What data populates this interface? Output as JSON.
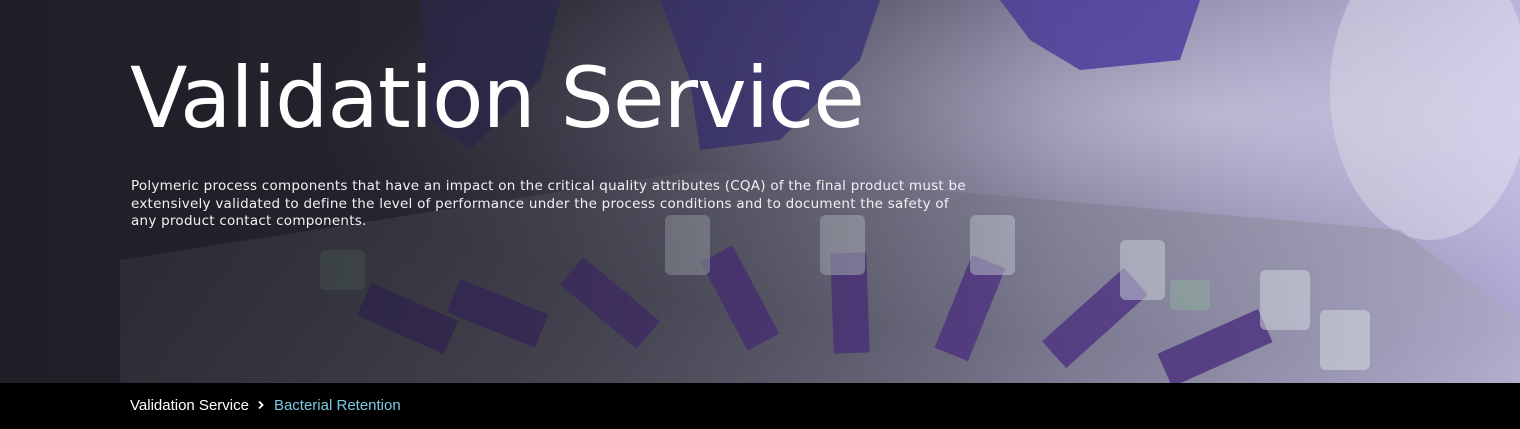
{
  "hero": {
    "title": "Validation Service",
    "description": "Polymeric process components that have an impact on the critical quality attributes (CQA) of the final product must be extensively validated to define the level of performance under the process conditions and to document the safety of any product contact components."
  },
  "breadcrumb": {
    "items": [
      {
        "label": "Validation Service"
      },
      {
        "label": "Bacterial Retention"
      }
    ],
    "separator_icon": "chevron-right-icon"
  },
  "colors": {
    "breadcrumb_active": "#7ec8e3",
    "breadcrumb_bar": "#000000",
    "glove_purple": "#5a48b0"
  }
}
